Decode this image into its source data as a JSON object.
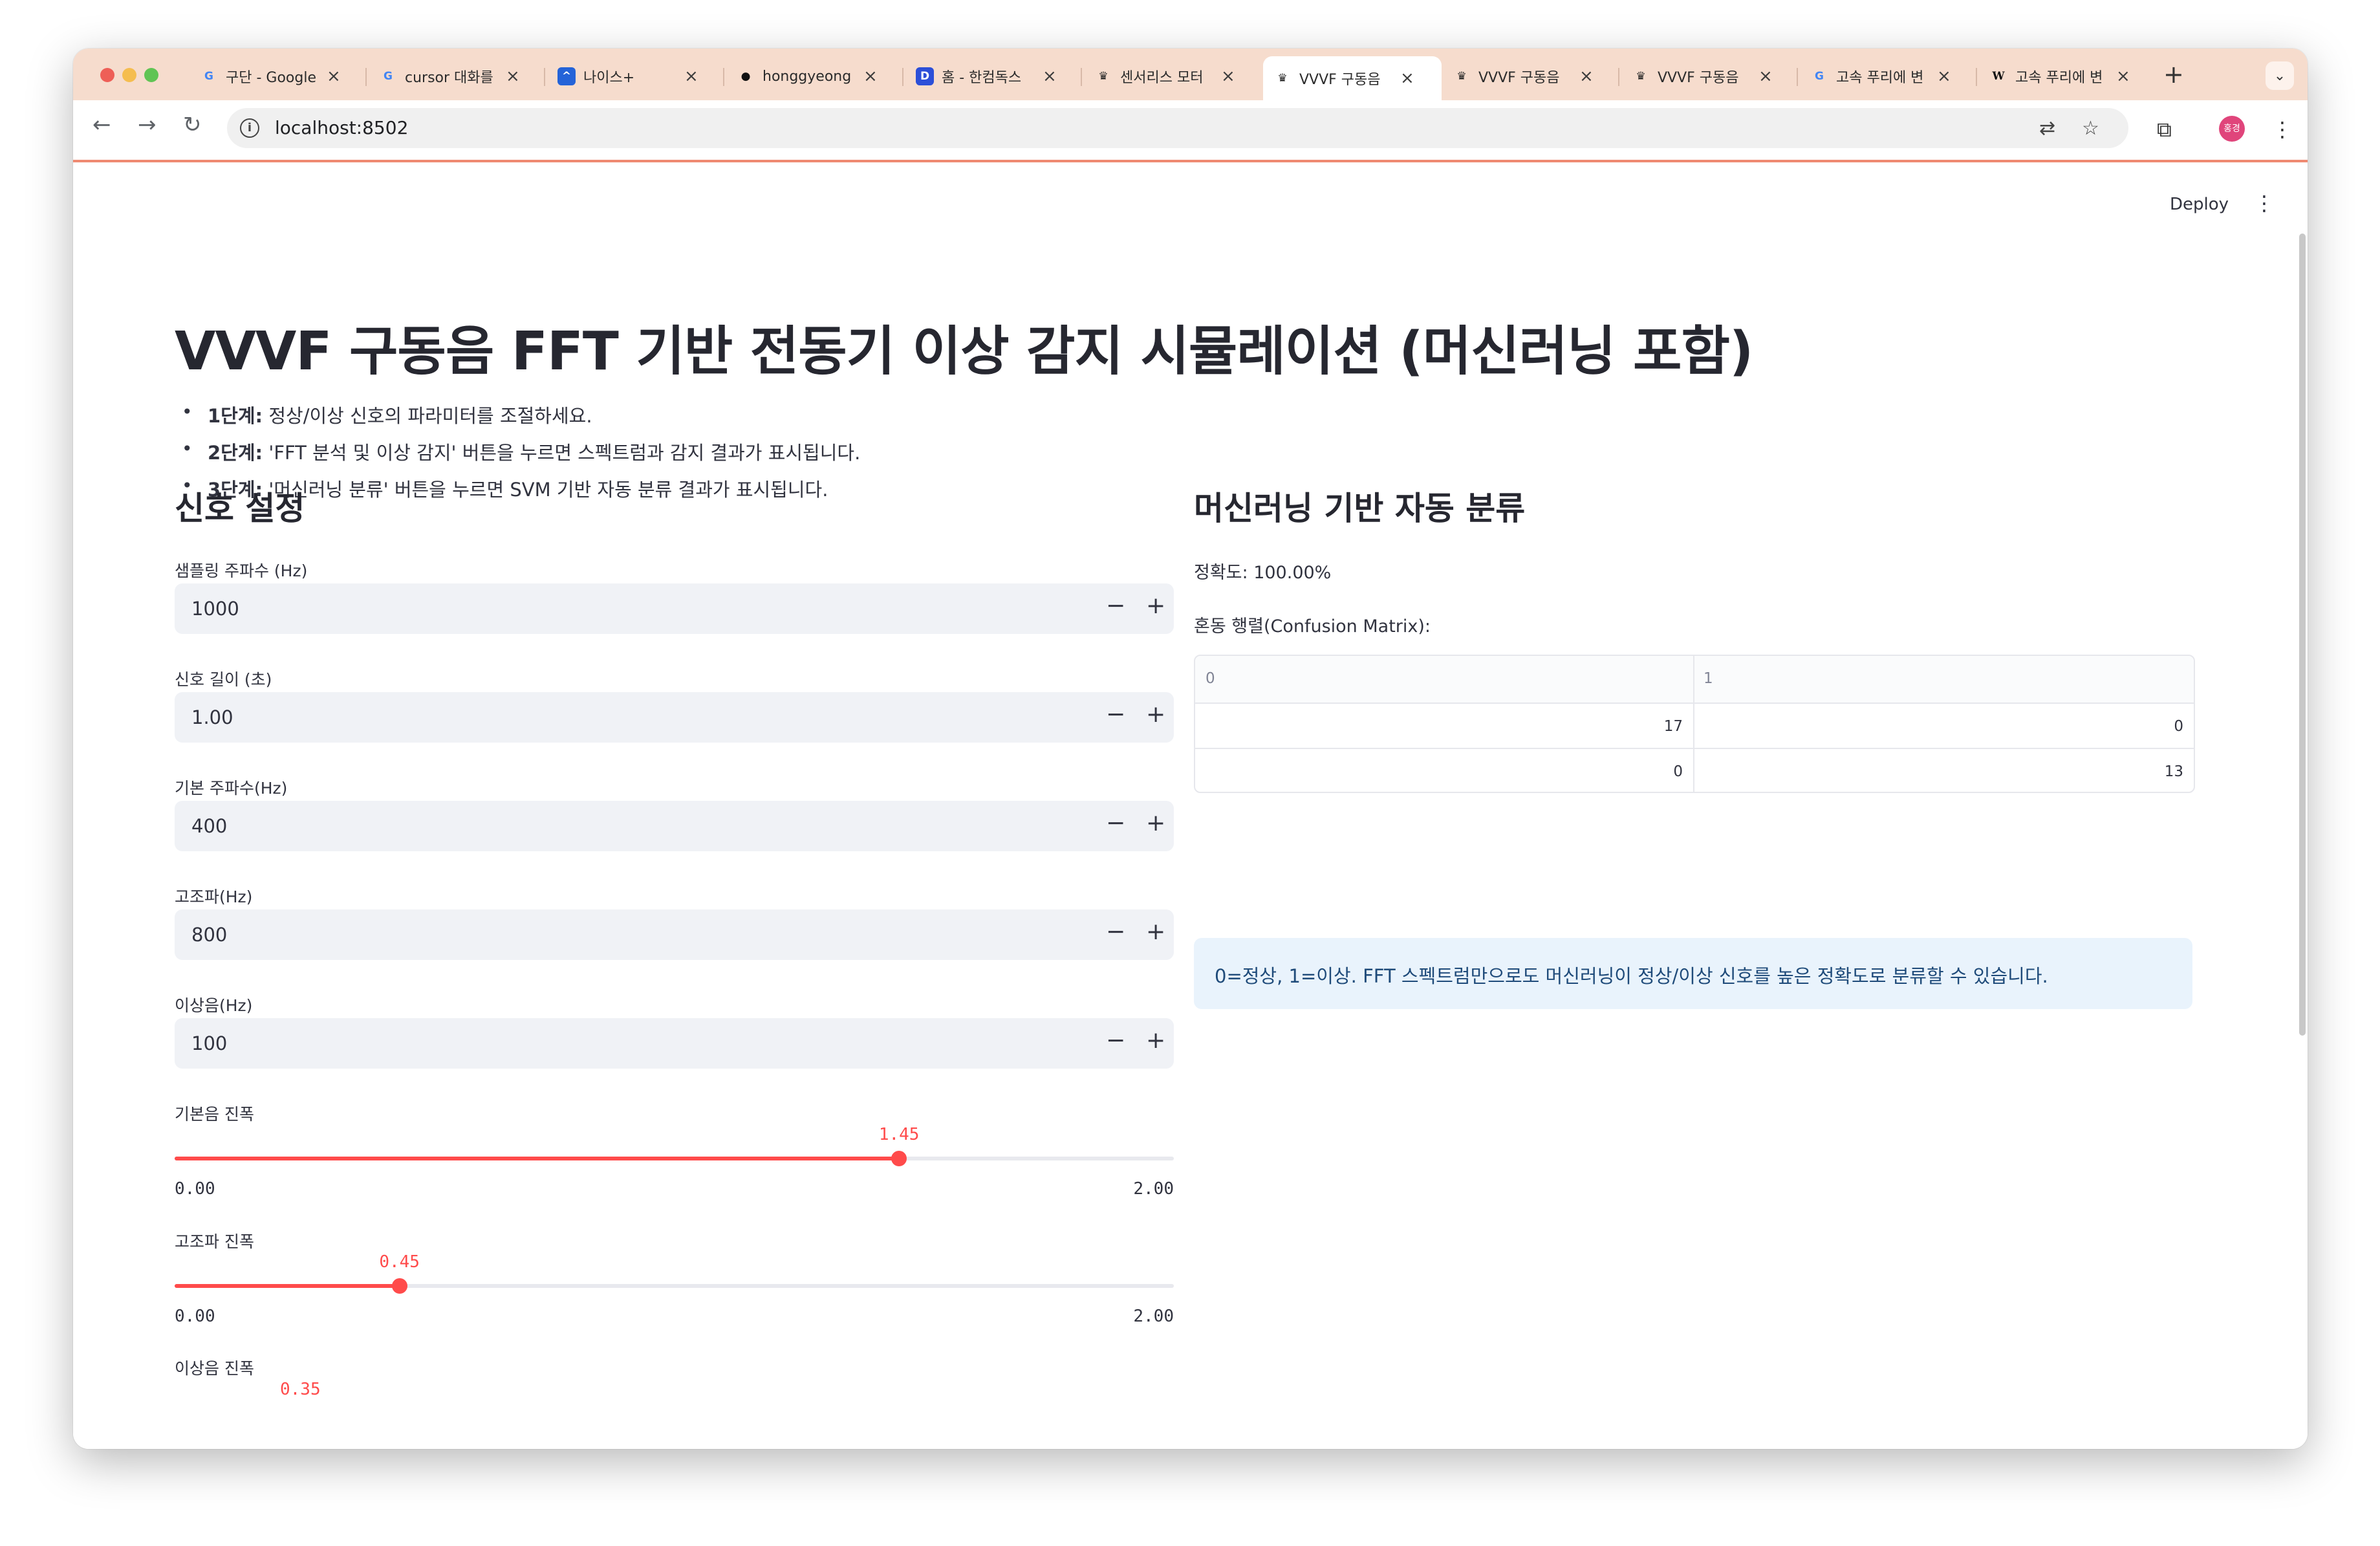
{
  "browser": {
    "tabs": [
      {
        "favicon": "G",
        "title": "구단 - Google"
      },
      {
        "favicon": "G",
        "title": "cursor 대화를"
      },
      {
        "favicon": "^",
        "title": "나이스+"
      },
      {
        "favicon": "●",
        "title": "honggyeong"
      },
      {
        "favicon": "D",
        "title": "홈 - 한컴독스"
      },
      {
        "favicon": "♛",
        "title": "센서리스 모터"
      },
      {
        "favicon": "♛",
        "title": "VVVF 구동음"
      },
      {
        "favicon": "♛",
        "title": "VVVF 구동음"
      },
      {
        "favicon": "♛",
        "title": "VVVF 구동음"
      },
      {
        "favicon": "G",
        "title": "고속 푸리에 변"
      },
      {
        "favicon": "W",
        "title": "고속 푸리에 변"
      }
    ],
    "url": "localhost:8502",
    "profile_initials": "홍경",
    "colors": {
      "tabstrip": "#f6dccd",
      "accent": "#ff4b4b"
    }
  },
  "app": {
    "deploy_label": "Deploy",
    "title": "VVVF 구동음 FFT 기반 전동기 이상 감지 시뮬레이션 (머신러닝 포함)",
    "steps": [
      {
        "bold": "1단계:",
        "text": " 정상/이상 신호의 파라미터를 조절하세요."
      },
      {
        "bold": "2단계:",
        "text": " 'FFT 분석 및 이상 감지' 버튼을 누르면 스펙트럼과 감지 결과가 표시됩니다."
      },
      {
        "bold": "3단계:",
        "text": " '머신러닝 분류' 버튼을 누르면 SVM 기반 자동 분류 결과가 표시됩니다."
      }
    ],
    "signal": {
      "heading": "신호 설정",
      "inputs": [
        {
          "label": "샘플링 주파수 (Hz)",
          "value": "1000"
        },
        {
          "label": "신호 길이 (초)",
          "value": "1.00"
        },
        {
          "label": "기본 주파수(Hz)",
          "value": "400"
        },
        {
          "label": "고조파(Hz)",
          "value": "800"
        },
        {
          "label": "이상음(Hz)",
          "value": "100"
        }
      ],
      "sliders": [
        {
          "label": "기본음 진폭",
          "value": "1.45",
          "min": "0.00",
          "max": "2.00",
          "fraction": 0.725
        },
        {
          "label": "고조파 진폭",
          "value": "0.45",
          "min": "0.00",
          "max": "2.00",
          "fraction": 0.225
        },
        {
          "label": "이상음 진폭",
          "value": "0.35"
        }
      ]
    },
    "ml": {
      "heading": "머신러닝 기반 자동 분류",
      "accuracy": "정확도: 100.00%",
      "cm_label": "혼동 행렬(Confusion Matrix):",
      "cm_headers": [
        "0",
        "1"
      ],
      "cm_rows": [
        [
          "17",
          "0"
        ],
        [
          "0",
          "13"
        ]
      ],
      "info": "0=정상, 1=이상. FFT 스펙트럼만으로도 머신러닝이 정상/이상 신호를 높은 정확도로 분류할 수 있습니다."
    }
  }
}
